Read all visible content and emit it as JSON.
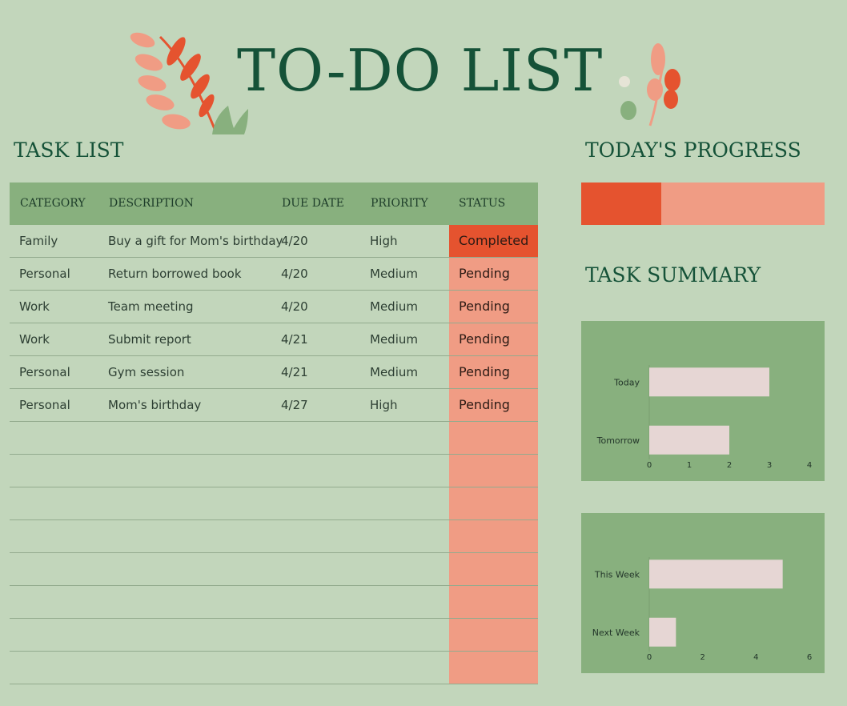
{
  "header": {
    "title": "TO-DO LIST"
  },
  "task_list": {
    "heading": "TASK LIST",
    "columns": [
      "CATEGORY",
      "DESCRIPTION",
      "DUE DATE",
      "PRIORITY",
      "STATUS"
    ],
    "rows": [
      {
        "category": "Family",
        "description": "Buy a gift for Mom's birthday",
        "due": "4/20",
        "priority": "High",
        "status": "Completed"
      },
      {
        "category": "Personal",
        "description": "Return borrowed book",
        "due": "4/20",
        "priority": "Medium",
        "status": "Pending"
      },
      {
        "category": "Work",
        "description": "Team meeting",
        "due": "4/20",
        "priority": "Medium",
        "status": "Pending"
      },
      {
        "category": "Work",
        "description": "Submit report",
        "due": "4/21",
        "priority": "Medium",
        "status": "Pending"
      },
      {
        "category": "Personal",
        "description": "Gym session",
        "due": "4/21",
        "priority": "Medium",
        "status": "Pending"
      },
      {
        "category": "Personal",
        "description": "Mom's birthday",
        "due": "4/27",
        "priority": "High",
        "status": "Pending"
      },
      {
        "category": "",
        "description": "",
        "due": "",
        "priority": "",
        "status": ""
      },
      {
        "category": "",
        "description": "",
        "due": "",
        "priority": "",
        "status": ""
      },
      {
        "category": "",
        "description": "",
        "due": "",
        "priority": "",
        "status": ""
      },
      {
        "category": "",
        "description": "",
        "due": "",
        "priority": "",
        "status": ""
      },
      {
        "category": "",
        "description": "",
        "due": "",
        "priority": "",
        "status": ""
      },
      {
        "category": "",
        "description": "",
        "due": "",
        "priority": "",
        "status": ""
      },
      {
        "category": "",
        "description": "",
        "due": "",
        "priority": "",
        "status": ""
      },
      {
        "category": "",
        "description": "",
        "due": "",
        "priority": "",
        "status": ""
      }
    ]
  },
  "progress": {
    "heading": "TODAY'S PROGRESS",
    "fraction": 0.33
  },
  "summary": {
    "heading": "TASK SUMMARY"
  },
  "colors": {
    "background": "#c2d6bb",
    "accent_green": "#88b07e",
    "title_green": "#155238",
    "completed": "#e5532f",
    "pending": "#f09c84",
    "bar": "#e6d6d4"
  },
  "chart_data": [
    {
      "type": "bar",
      "orientation": "horizontal",
      "categories": [
        "Today",
        "Tomorrow"
      ],
      "values": [
        3,
        2
      ],
      "xlim": [
        0,
        4
      ],
      "ticks": [
        0,
        1,
        2,
        3,
        4
      ]
    },
    {
      "type": "bar",
      "orientation": "horizontal",
      "categories": [
        "This Week",
        "Next Week"
      ],
      "values": [
        5,
        1
      ],
      "xlim": [
        0,
        6
      ],
      "ticks": [
        0,
        2,
        4,
        6
      ]
    }
  ]
}
